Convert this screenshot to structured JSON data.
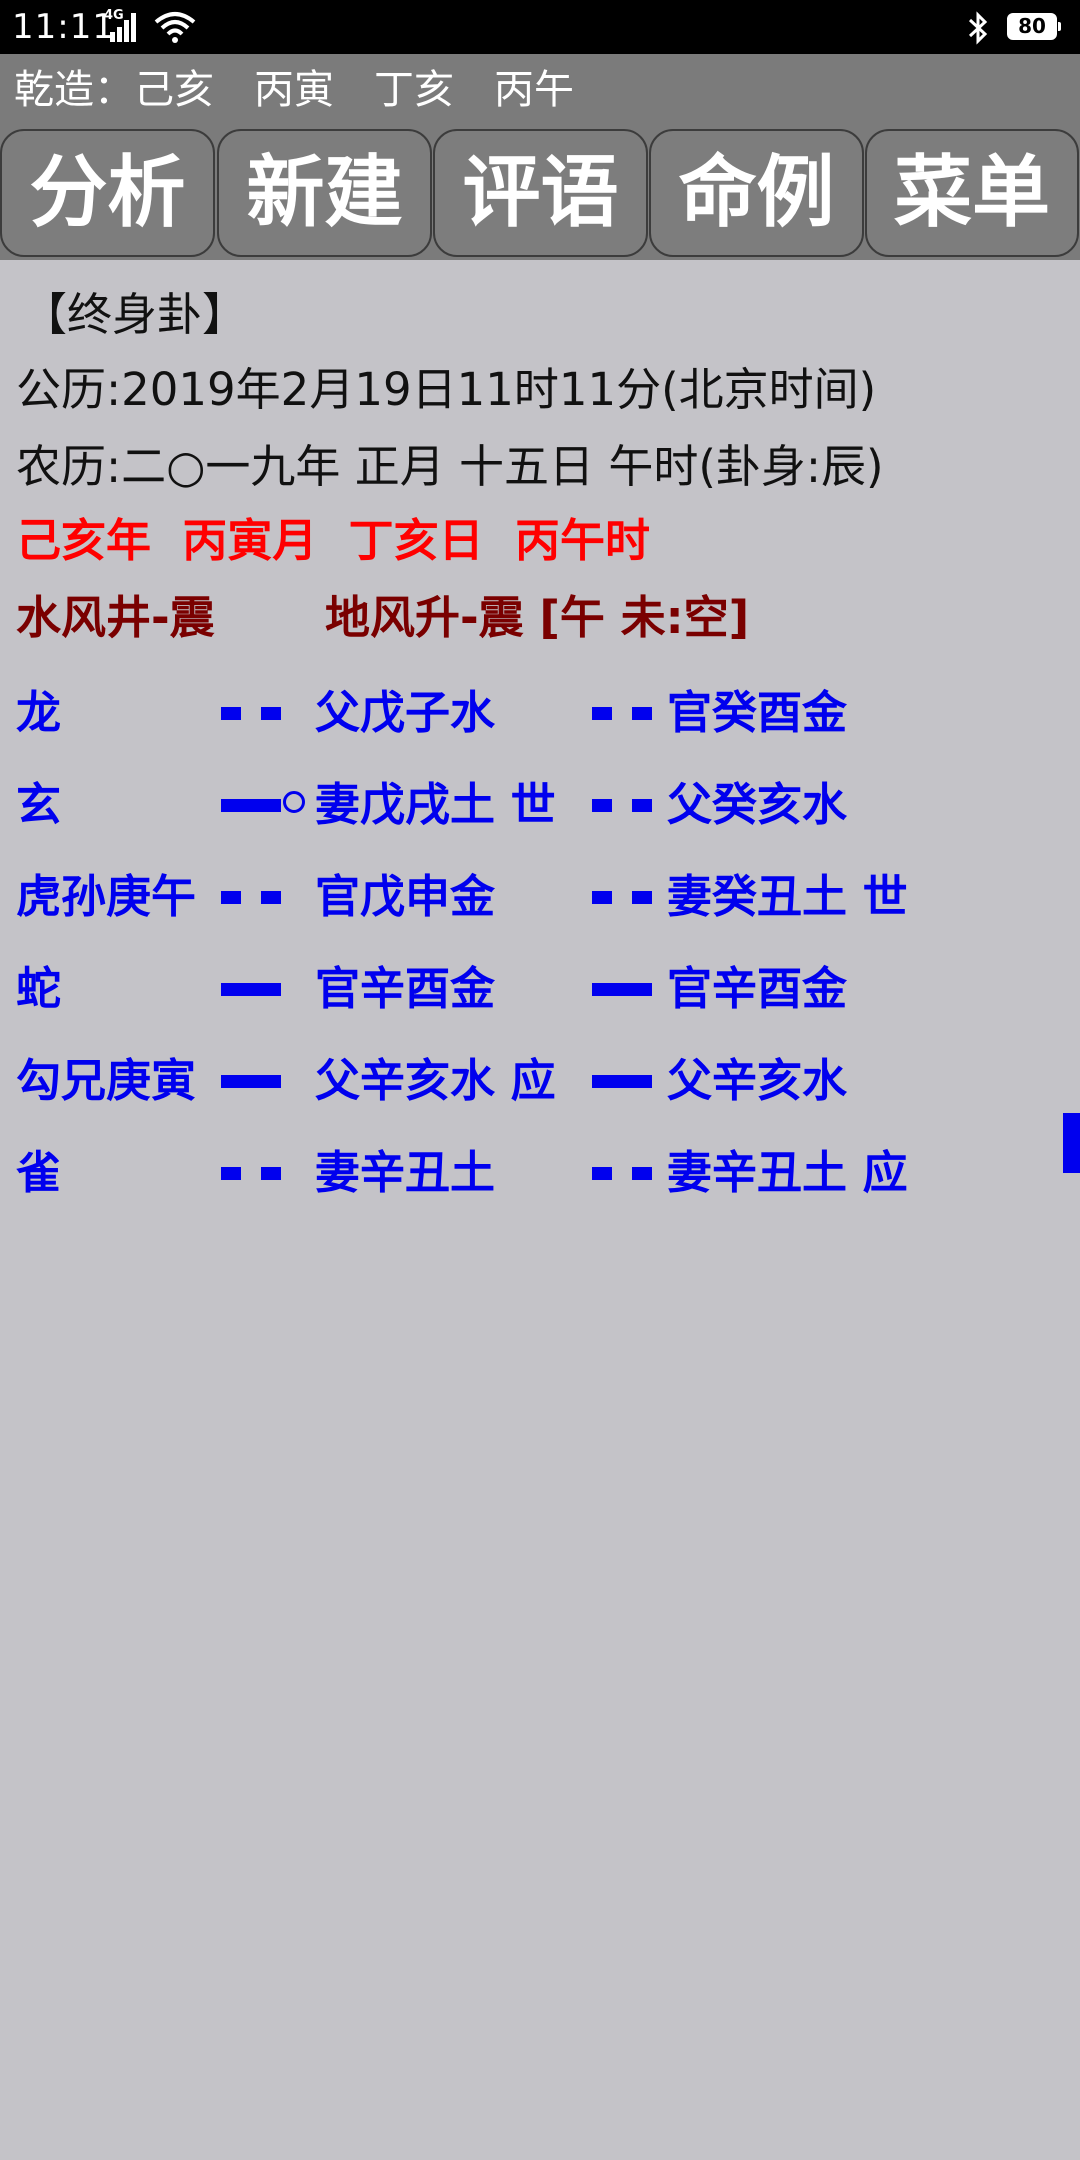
{
  "status_bar": {
    "time": "11:11",
    "network": "4G",
    "battery": "80"
  },
  "title_bar": {
    "text": "乾造：己亥　丙寅　丁亥　丙午"
  },
  "toolbar": {
    "buttons": [
      "分析",
      "新建",
      "评语",
      "命例",
      "菜单"
    ]
  },
  "info": {
    "heading": "【终身卦】",
    "solar": "公历:2019年2月19日11时11分(北京时间)",
    "lunar": "农历:二○一九年 正月 十五日 午时(卦身:辰)",
    "ganzhi": "己亥年  丙寅月  丁亥日  丙午时",
    "main_hexagram": "水风井-震",
    "changed_hexagram": "地风升-震 [午 未:空]"
  },
  "lines": [
    {
      "spirit": "龙",
      "main": "父戊子水",
      "main_yao": "yin",
      "changed": "官癸酉金",
      "changed_yao": "yin"
    },
    {
      "spirit": "玄",
      "main": "妻戊戌土 世",
      "main_yao": "yang",
      "moving": true,
      "changed": "父癸亥水",
      "changed_yao": "yin"
    },
    {
      "spirit": "虎孙庚午",
      "main": "官戊申金",
      "main_yao": "yin",
      "changed": "妻癸丑土 世",
      "changed_yao": "yin"
    },
    {
      "spirit": "蛇",
      "main": "官辛酉金",
      "main_yao": "yang",
      "changed": "官辛酉金",
      "changed_yao": "yang"
    },
    {
      "spirit": "勾兄庚寅",
      "main": "父辛亥水 应",
      "main_yao": "yang",
      "changed": "父辛亥水",
      "changed_yao": "yang"
    },
    {
      "spirit": "雀",
      "main": "妻辛丑土",
      "main_yao": "yin",
      "changed": "妻辛丑土 应",
      "changed_yao": "yin"
    }
  ],
  "colors": {
    "accent_blue": "#0000ee",
    "ganzhi_red": "#ff0000",
    "hexagram_darkred": "#7a0000",
    "toolbar_gray": "#7b7b7b",
    "background": "#c4c3c8"
  }
}
